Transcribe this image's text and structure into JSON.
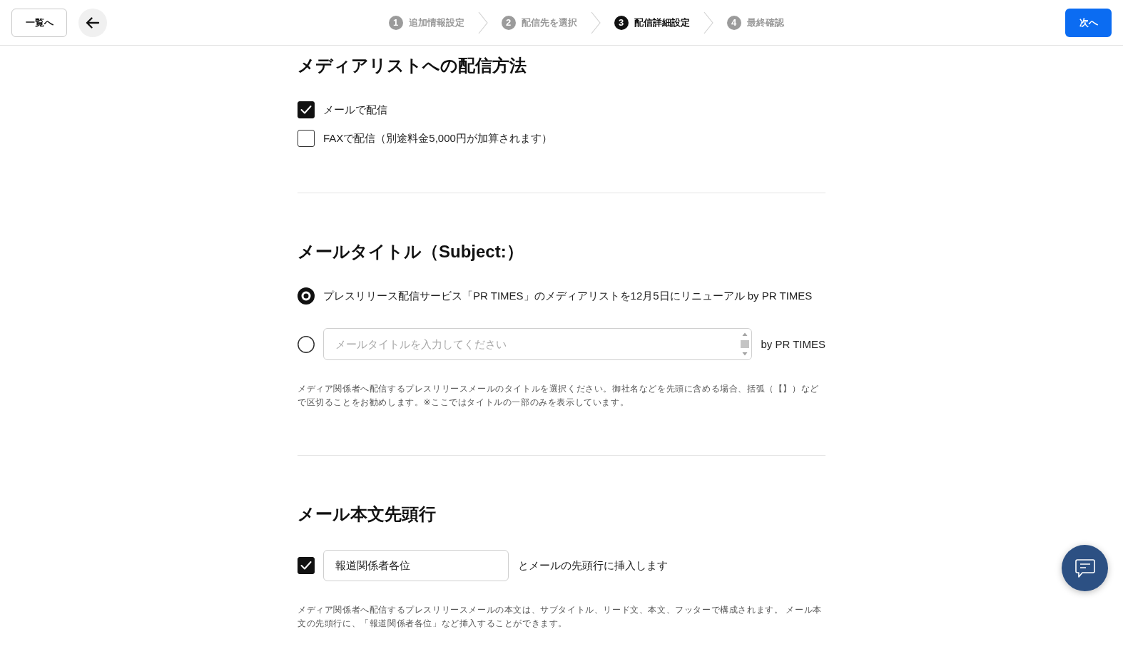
{
  "header": {
    "list_button": "一覧へ",
    "steps": [
      {
        "number": "1",
        "label": "追加情報設定",
        "selected": false
      },
      {
        "number": "2",
        "label": "配信先を選択",
        "selected": false
      },
      {
        "number": "3",
        "label": "配信詳細設定",
        "selected": true
      },
      {
        "number": "4",
        "label": "最終確認",
        "selected": false
      }
    ],
    "next_button": "次へ"
  },
  "delivery_method": {
    "title": "メディアリストへの配信方法",
    "options": [
      {
        "label": "メールで配信",
        "checked": true
      },
      {
        "label": "FAXで配信（別途料金5,000円が加算されます）",
        "checked": false
      }
    ]
  },
  "mail_title": {
    "title": "メールタイトル（Subject:）",
    "options": [
      {
        "kind": "preset",
        "label": "プレスリリース配信サービス「PR TIMES」のメディアリストを12月5日にリニューアル by PR TIMES",
        "selected": true
      },
      {
        "kind": "custom",
        "placeholder": "メールタイトルを入力してください",
        "suffix": "by PR TIMES",
        "selected": false
      }
    ],
    "help": "メディア関係者へ配信するプレスリリースメールのタイトルを選択ください。御社名などを先頭に含める場合、括弧（【】）などで区切ることをお勧めします。※ここではタイトルの一部のみを表示しています。"
  },
  "mail_first_line": {
    "title": "メール本文先頭行",
    "checked": true,
    "value": "報道関係者各位",
    "suffix": "とメールの先頭行に挿入します",
    "help": "メディア関係者へ配信するプレスリリースメールの本文は、サブタイトル、リード文、本文、フッターで構成されます。 メール本文の先頭行に、「報道関係者各位」など挿入することができます。"
  }
}
